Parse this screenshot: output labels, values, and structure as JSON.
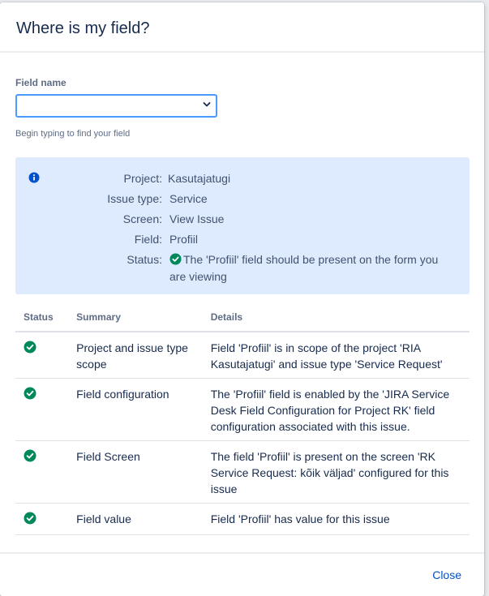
{
  "dialog": {
    "title": "Where is my field?"
  },
  "field_search": {
    "label": "Field name",
    "value": "",
    "help": "Begin typing to find your field"
  },
  "info": {
    "icon": "info-icon",
    "rows": [
      {
        "key": "Project:",
        "value": "Kasutajatugi"
      },
      {
        "key": "Issue type:",
        "value": "Service"
      },
      {
        "key": "Screen:",
        "value": "View Issue"
      },
      {
        "key": "Field:",
        "value": "Profiil"
      }
    ],
    "status_key": "Status:",
    "status_icon": "check-circle-icon",
    "status_text": "The 'Profiil' field should be present on the form you are viewing"
  },
  "table": {
    "headers": [
      "Status",
      "Summary",
      "Details"
    ],
    "rows": [
      {
        "status_icon": "check-circle-icon",
        "summary": "Project and issue type scope",
        "details": "Field 'Profiil' is in scope of the project 'RIA Kasutajatugi' and issue type 'Service Request'"
      },
      {
        "status_icon": "check-circle-icon",
        "summary": "Field configuration",
        "details": "The 'Profiil' field is enabled by the 'JIRA Service Desk Field Configuration for Project RK' field configuration associated with this issue."
      },
      {
        "status_icon": "check-circle-icon",
        "summary": "Field Screen",
        "details": "The field 'Profiil' is present on the screen 'RK Service Request: kõik väljad' configured for this issue"
      },
      {
        "status_icon": "check-circle-icon",
        "summary": "Field value",
        "details": "Field 'Profiil' has value for this issue"
      }
    ]
  },
  "footer": {
    "close_label": "Close"
  },
  "colors": {
    "accent": "#0052cc",
    "focus_border": "#4c9aff",
    "info_bg": "#deebff",
    "success": "#00875a"
  }
}
